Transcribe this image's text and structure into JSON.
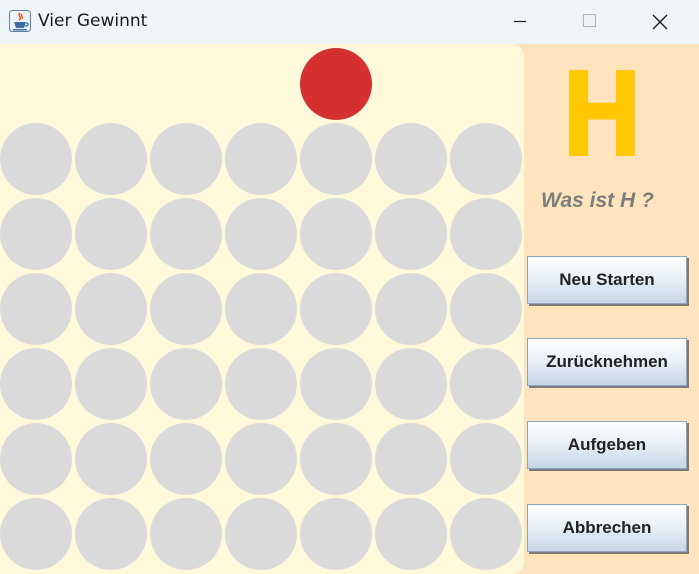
{
  "window": {
    "title": "Vier Gewinnt",
    "icon": "java-cup-icon",
    "controls": [
      "minimize-icon",
      "maximize-icon",
      "close-icon"
    ]
  },
  "board": {
    "columns": 7,
    "rows": 6,
    "empty_color": "#dadada",
    "background_color": "#fff9dc",
    "cells": [
      [
        "empty",
        "empty",
        "empty",
        "empty",
        "empty",
        "empty",
        "empty"
      ],
      [
        "empty",
        "empty",
        "empty",
        "empty",
        "empty",
        "empty",
        "empty"
      ],
      [
        "empty",
        "empty",
        "empty",
        "empty",
        "empty",
        "empty",
        "empty"
      ],
      [
        "empty",
        "empty",
        "empty",
        "empty",
        "empty",
        "empty",
        "empty"
      ],
      [
        "empty",
        "empty",
        "empty",
        "empty",
        "empty",
        "empty",
        "empty"
      ],
      [
        "empty",
        "empty",
        "empty",
        "empty",
        "empty",
        "empty",
        "empty"
      ]
    ],
    "hover_piece": {
      "column": 5,
      "color": "#d3302f"
    }
  },
  "sidebar": {
    "player_letter": "H",
    "player_letter_color": "#ffc800",
    "hint": "Was ist H ?",
    "buttons": {
      "restart": "Neu Starten",
      "undo": "Zurücknehmen",
      "give_up": "Aufgeben",
      "cancel": "Abbrechen"
    }
  }
}
